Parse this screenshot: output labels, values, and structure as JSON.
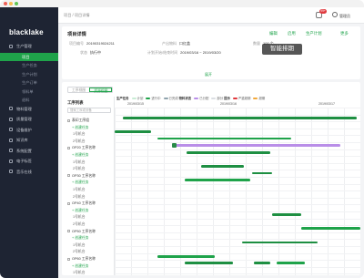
{
  "app": {
    "name": "blacklake"
  },
  "sidebar": {
    "items": [
      {
        "label": "生产管理",
        "active": false,
        "sub": false
      },
      {
        "label": "项目",
        "active": true,
        "sub": true
      },
      {
        "label": "生产任务",
        "active": false,
        "sub": true
      },
      {
        "label": "生产计划",
        "active": false,
        "sub": true
      },
      {
        "label": "生产订单",
        "active": false,
        "sub": true
      },
      {
        "label": "领料单",
        "active": false,
        "sub": true
      },
      {
        "label": "退料",
        "active": false,
        "sub": true
      },
      {
        "label": "物料管理",
        "active": false,
        "sub": false
      },
      {
        "label": "质量管理",
        "active": false,
        "sub": false
      },
      {
        "label": "设备维护",
        "active": false,
        "sub": false
      },
      {
        "label": "知识库",
        "active": false,
        "sub": false
      },
      {
        "label": "系统配置",
        "active": false,
        "sub": false
      },
      {
        "label": "电子标签",
        "active": false,
        "sub": false
      },
      {
        "label": "音乐在线",
        "active": false,
        "sub": false
      }
    ]
  },
  "header": {
    "breadcrumb": "项目 / 项目详情",
    "notif_count": "99+",
    "username": "管理员"
  },
  "project": {
    "title": "项目详情",
    "actions": [
      "编辑",
      "启用",
      "生产计划",
      "更多"
    ],
    "fields": [
      {
        "label": "项目编号",
        "value": "20190319024211"
      },
      {
        "label": "产出物料",
        "value": "口红盖"
      },
      {
        "label": "数量",
        "value": "100 个"
      },
      {
        "label": "状态",
        "value": "执行中"
      },
      {
        "label": "计划开始/结束时间",
        "value": "2019/03/16 ~ 2019/03/20"
      }
    ],
    "collapse_label": "展开"
  },
  "smart_tag": "智能排期",
  "schedule": {
    "view_options": [
      "工序视图",
      "资源视图"
    ],
    "resource_title": "工序列表",
    "search_placeholder": "搜索工序或设备",
    "resources": [
      {
        "label": "表印工序组",
        "kind": "g"
      },
      {
        "label": "+ 创建任务",
        "kind": "add"
      },
      {
        "label": "1号机台",
        "kind": "m"
      },
      {
        "label": "2号机台",
        "kind": "m"
      },
      {
        "label": "OP20 工序名称",
        "kind": "g"
      },
      {
        "label": "+ 创建任务",
        "kind": "add"
      },
      {
        "label": "1号机台",
        "kind": "m"
      },
      {
        "label": "2号机台",
        "kind": "m"
      },
      {
        "label": "OP30 工序名称",
        "kind": "g"
      },
      {
        "label": "+ 创建任务",
        "kind": "add"
      },
      {
        "label": "1号机台",
        "kind": "m"
      },
      {
        "label": "2号机台",
        "kind": "m"
      },
      {
        "label": "OP40 工序名称",
        "kind": "g"
      },
      {
        "label": "+ 创建任务",
        "kind": "add"
      },
      {
        "label": "1号机台",
        "kind": "m"
      },
      {
        "label": "2号机台",
        "kind": "m"
      },
      {
        "label": "OP50 工序名称",
        "kind": "g"
      },
      {
        "label": "+ 创建任务",
        "kind": "add"
      },
      {
        "label": "1号机台",
        "kind": "m"
      },
      {
        "label": "2号机台",
        "kind": "m"
      },
      {
        "label": "OP60 工序名称",
        "kind": "g"
      },
      {
        "label": "+ 创建任务",
        "kind": "add"
      },
      {
        "label": "1号机台",
        "kind": "m"
      },
      {
        "label": "2号机台",
        "kind": "m"
      }
    ],
    "legend": {
      "group1": "生产任务",
      "items1": [
        "计划",
        "进行中",
        "已完成"
      ],
      "group2": "物料状态",
      "items2": [
        "已分配",
        "部分"
      ],
      "group3": "提示",
      "items3": [
        "严重超期",
        "超期"
      ]
    },
    "legend_colors": {
      "planned": "#c9ecd5",
      "running": "#1fa34a",
      "done": "#8fa3ad",
      "alloc": "#b98ee8",
      "partial": "#dcdfe3",
      "severe": "#e0393e",
      "late": "#f2a93b"
    },
    "dates": [
      "2019/03/15",
      "2019/03/16",
      "2019/03/17"
    ],
    "tasks": [
      {
        "row": 1,
        "start": 0.5,
        "end": 14.8,
        "color": "#1e8f42",
        "handle": false
      },
      {
        "row": 3,
        "start": 0.0,
        "end": 2.2,
        "color": "#1e8f42",
        "handle": false
      },
      {
        "row": 4,
        "start": 2.6,
        "end": 10.8,
        "color": "#1fa34a",
        "handle": false
      },
      {
        "row": 5,
        "start": 3.6,
        "end": 13.8,
        "color": "#b98ee8",
        "handle": true
      },
      {
        "row": 6,
        "start": 4.4,
        "end": 9.5,
        "color": "#1e8f42",
        "handle": false
      },
      {
        "row": 8,
        "start": 5.3,
        "end": 7.9,
        "color": "#1e8f42",
        "handle": false
      },
      {
        "row": 9,
        "start": 8.4,
        "end": 9.6,
        "color": "#1e8f42",
        "handle": false
      },
      {
        "row": 10,
        "start": 4.3,
        "end": 8.3,
        "color": "#1fa34a",
        "handle": false
      },
      {
        "row": 15,
        "start": 9.6,
        "end": 11.4,
        "color": "#1e8f42",
        "handle": false
      },
      {
        "row": 17,
        "start": 11.4,
        "end": 15.0,
        "color": "#1fa34a",
        "handle": false
      },
      {
        "row": 19,
        "start": 7.8,
        "end": 12.4,
        "color": "#1e8f42",
        "handle": false
      },
      {
        "row": 21,
        "start": 2.6,
        "end": 6.1,
        "color": "#1fa34a",
        "handle": false
      },
      {
        "row": 22,
        "start": 4.3,
        "end": 7.2,
        "color": "#1e8f42",
        "handle": false
      },
      {
        "row": 22,
        "start": 8.5,
        "end": 9.5,
        "color": "#1e8f42",
        "handle": false
      },
      {
        "row": 22,
        "start": 9.9,
        "end": 11.6,
        "color": "#1fa34a",
        "handle": false
      }
    ]
  }
}
